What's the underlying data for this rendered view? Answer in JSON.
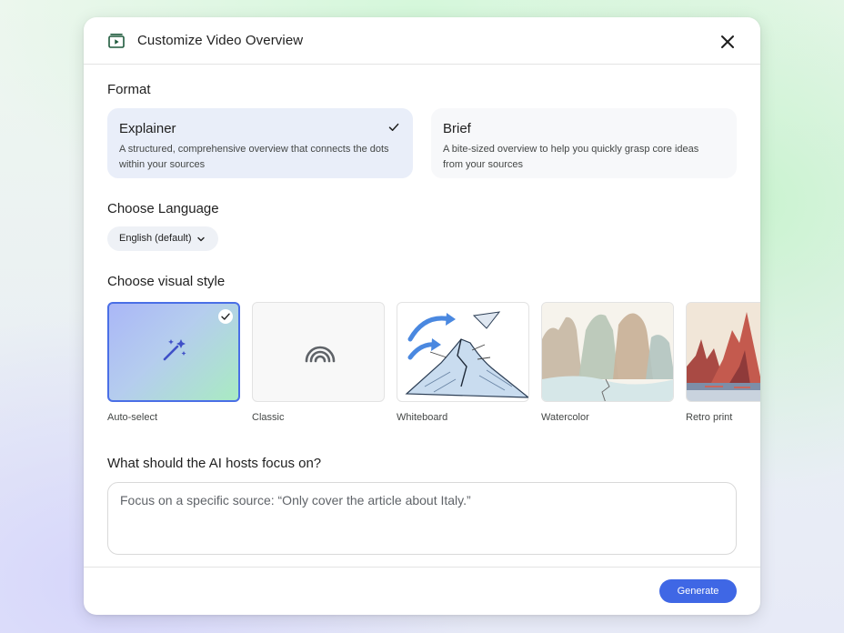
{
  "dialog": {
    "title": "Customize Video Overview",
    "header_icon": "video-overview-icon",
    "close_icon": "close-icon"
  },
  "format": {
    "label": "Format",
    "options": [
      {
        "title": "Explainer",
        "description": "A structured, comprehensive overview that connects the dots within your sources",
        "selected": true
      },
      {
        "title": "Brief",
        "description": "A bite-sized overview to help you quickly grasp core ideas from your sources",
        "selected": false
      }
    ]
  },
  "language": {
    "label": "Choose Language",
    "selected": "English (default)"
  },
  "visual_style": {
    "label": "Choose visual style",
    "options": [
      {
        "name": "Auto-select",
        "selected": true,
        "icon": "magic-wand-icon"
      },
      {
        "name": "Classic",
        "selected": false,
        "icon": "rainbow-arcs-icon"
      },
      {
        "name": "Whiteboard",
        "selected": false
      },
      {
        "name": "Watercolor",
        "selected": false
      },
      {
        "name": "Retro print",
        "selected": false
      }
    ]
  },
  "focus": {
    "label": "What should the AI hosts focus on?",
    "placeholder": "Focus on a specific source: “Only cover the article about Italy.”"
  },
  "footer": {
    "generate_label": "Generate"
  },
  "colors": {
    "accent": "#3f67e5",
    "selected_card": "#e9eef9",
    "auto_border": "#4a6fe6"
  }
}
